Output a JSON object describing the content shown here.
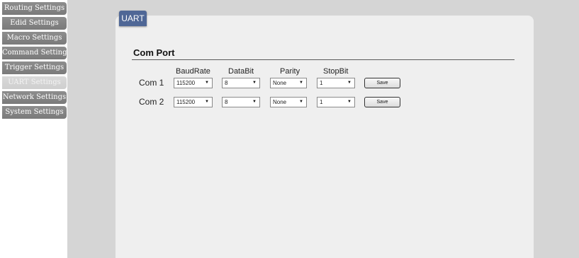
{
  "sidebar": {
    "items": [
      {
        "label": "Routing Settings"
      },
      {
        "label": "Edid Settings"
      },
      {
        "label": "Macro Settings"
      },
      {
        "label": "Command Settings"
      },
      {
        "label": "Trigger Settings"
      },
      {
        "label": "UART Settings"
      },
      {
        "label": "Network Settings"
      },
      {
        "label": "System Settings"
      }
    ]
  },
  "tab": {
    "label": "UART"
  },
  "section": {
    "title": "Com Port"
  },
  "columns": {
    "baud": "BaudRate",
    "data": "DataBit",
    "parity": "Parity",
    "stop": "StopBit"
  },
  "rows": [
    {
      "label": "Com 1",
      "baud": "115200",
      "data": "8",
      "parity": "None",
      "stop": "1",
      "save": "Save"
    },
    {
      "label": "Com 2",
      "baud": "115200",
      "data": "8",
      "parity": "None",
      "stop": "1",
      "save": "Save"
    }
  ],
  "colors": {
    "nav_bg": "#858585",
    "nav_active_bg": "#d4d4d4",
    "tab_bg": "#4f6796",
    "main_bg": "#d5d5d5",
    "panel_bg": "#efefef"
  }
}
